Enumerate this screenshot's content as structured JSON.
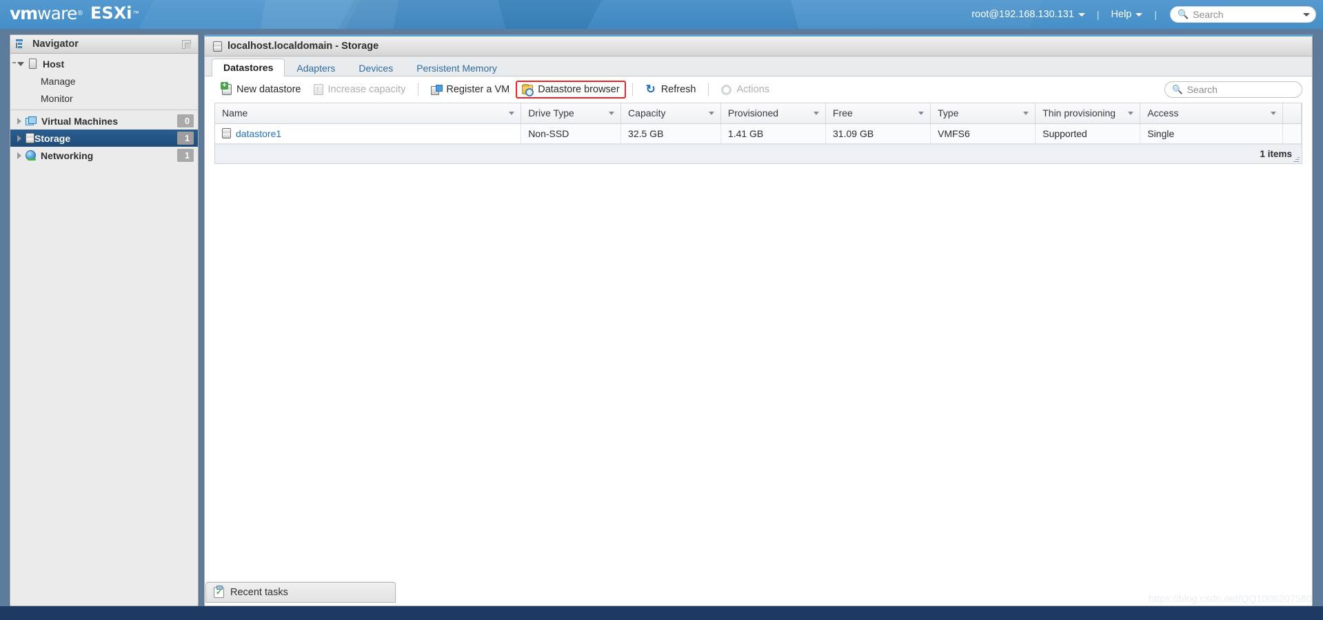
{
  "header": {
    "brand_vm": "vm",
    "brand_ware": "ware",
    "brand_reg": "®",
    "brand_product": "ESXi",
    "brand_tm": "™",
    "user": "root@192.168.130.131",
    "help_label": "Help",
    "separator": "|",
    "search_placeholder": "Search",
    "search_icon": "search-icon"
  },
  "navigator": {
    "title": "Navigator",
    "collapse_icon": "collapse-panel-icon",
    "items": [
      {
        "label": "Host",
        "icon": "host-icon",
        "expanded": true,
        "count": null
      },
      {
        "label": "Manage",
        "icon": null,
        "count": null
      },
      {
        "label": "Monitor",
        "icon": null,
        "count": null
      },
      {
        "label": "Virtual Machines",
        "icon": "virtual-machines-icon",
        "count": "0"
      },
      {
        "label": "Storage",
        "icon": "storage-icon",
        "count": "1",
        "selected": true
      },
      {
        "label": "Networking",
        "icon": "networking-icon",
        "count": "1"
      }
    ]
  },
  "main": {
    "title": "localhost.localdomain - Storage",
    "title_icon": "storage-icon",
    "tabs": [
      {
        "label": "Datastores",
        "active": true
      },
      {
        "label": "Adapters",
        "active": false
      },
      {
        "label": "Devices",
        "active": false
      },
      {
        "label": "Persistent Memory",
        "active": false
      }
    ],
    "toolbar": {
      "new_datastore": "New datastore",
      "increase_capacity": "Increase capacity",
      "register_vm": "Register a VM",
      "datastore_browser": "Datastore browser",
      "refresh": "Refresh",
      "actions": "Actions",
      "search_placeholder": "Search",
      "highlight_color": "#f02121"
    },
    "table": {
      "columns": [
        "Name",
        "Drive Type",
        "Capacity",
        "Provisioned",
        "Free",
        "Type",
        "Thin provisioning",
        "Access"
      ],
      "rows": [
        {
          "name": "datastore1",
          "drive_type": "Non-SSD",
          "capacity": "32.5 GB",
          "provisioned": "1.41 GB",
          "free": "31.09 GB",
          "type": "VMFS6",
          "thin_provisioning": "Supported",
          "access": "Single"
        }
      ],
      "footer_count": "1 items"
    }
  },
  "recent_tasks": {
    "label": "Recent tasks",
    "icon": "tasks-clipboard-icon"
  },
  "watermark": "https://blog.csdn.net/QQ1006207580"
}
